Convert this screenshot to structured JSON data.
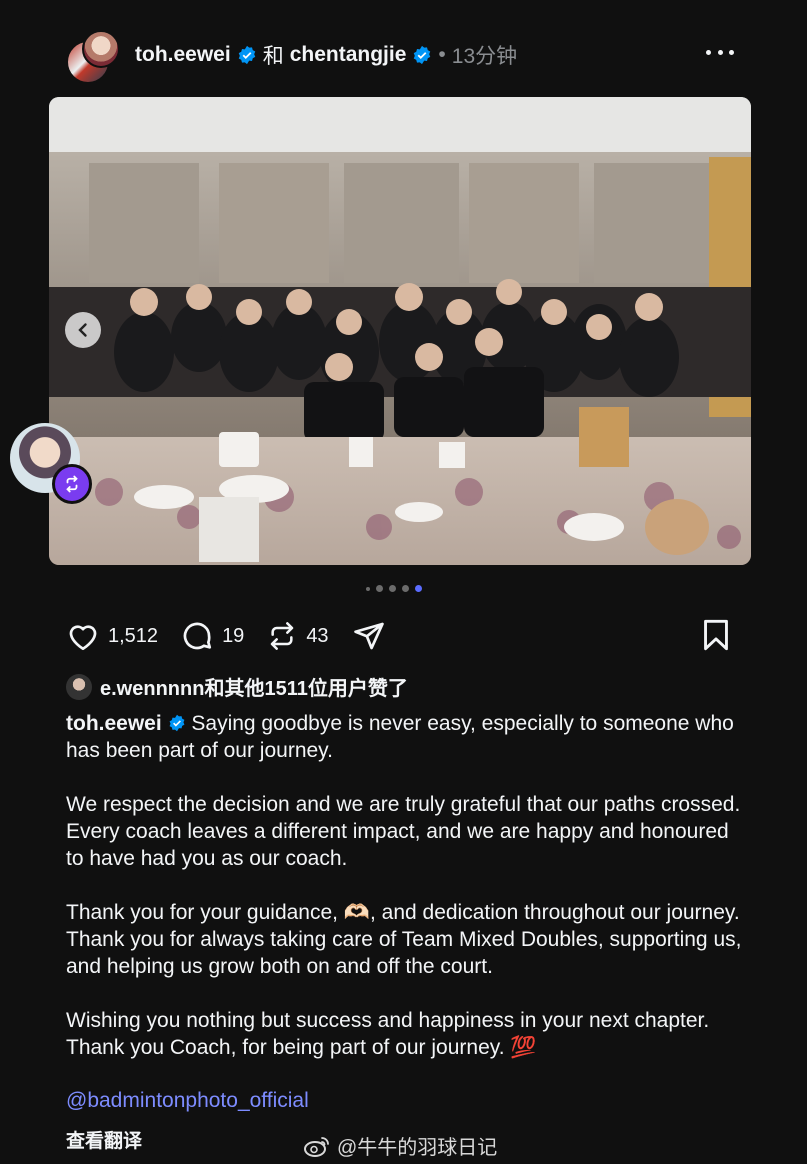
{
  "post": {
    "author": "toh.eewei",
    "conjunction": "和",
    "coauthor": "chentangjie",
    "separator": "•",
    "time": "13分钟"
  },
  "carousel": {
    "total": 5,
    "active_index": 4
  },
  "actions": {
    "likes": "1,512",
    "comments": "19",
    "reposts": "43"
  },
  "liked_by": "e.wennnnn和其他1511位用户赞了",
  "caption": {
    "username": "toh.eewei",
    "paragraphs": [
      "Saying goodbye is never easy, especially to someone who has been part of our journey.",
      "We respect the decision and we are truly grateful that our paths crossed. Every coach leaves a different impact, and we are happy and honoured to have had you as our coach.",
      "Thank you for your guidance, 🫶🏻, and dedication throughout our journey. Thank you for always taking care of Team Mixed Doubles, supporting us, and helping us grow both on and off the court.",
      "Wishing you nothing but success and happiness in your next chapter. Thank you Coach, for being part of our journey. 💯"
    ]
  },
  "mention": "@badmintonphoto_official",
  "translate_label": "查看翻译",
  "watermark": "@牛牛的羽球日记",
  "colors": {
    "background": "#101010",
    "text": "#f3f5f7",
    "muted": "#8a8d91",
    "verified": "#0095f6",
    "link": "#7d8cff",
    "active_dot": "#5b6cff"
  },
  "icons": [
    "more-icon",
    "heart-icon",
    "comment-icon",
    "repost-icon",
    "share-icon",
    "bookmark-icon",
    "chevron-left-icon",
    "verified-icon",
    "weibo-icon"
  ]
}
